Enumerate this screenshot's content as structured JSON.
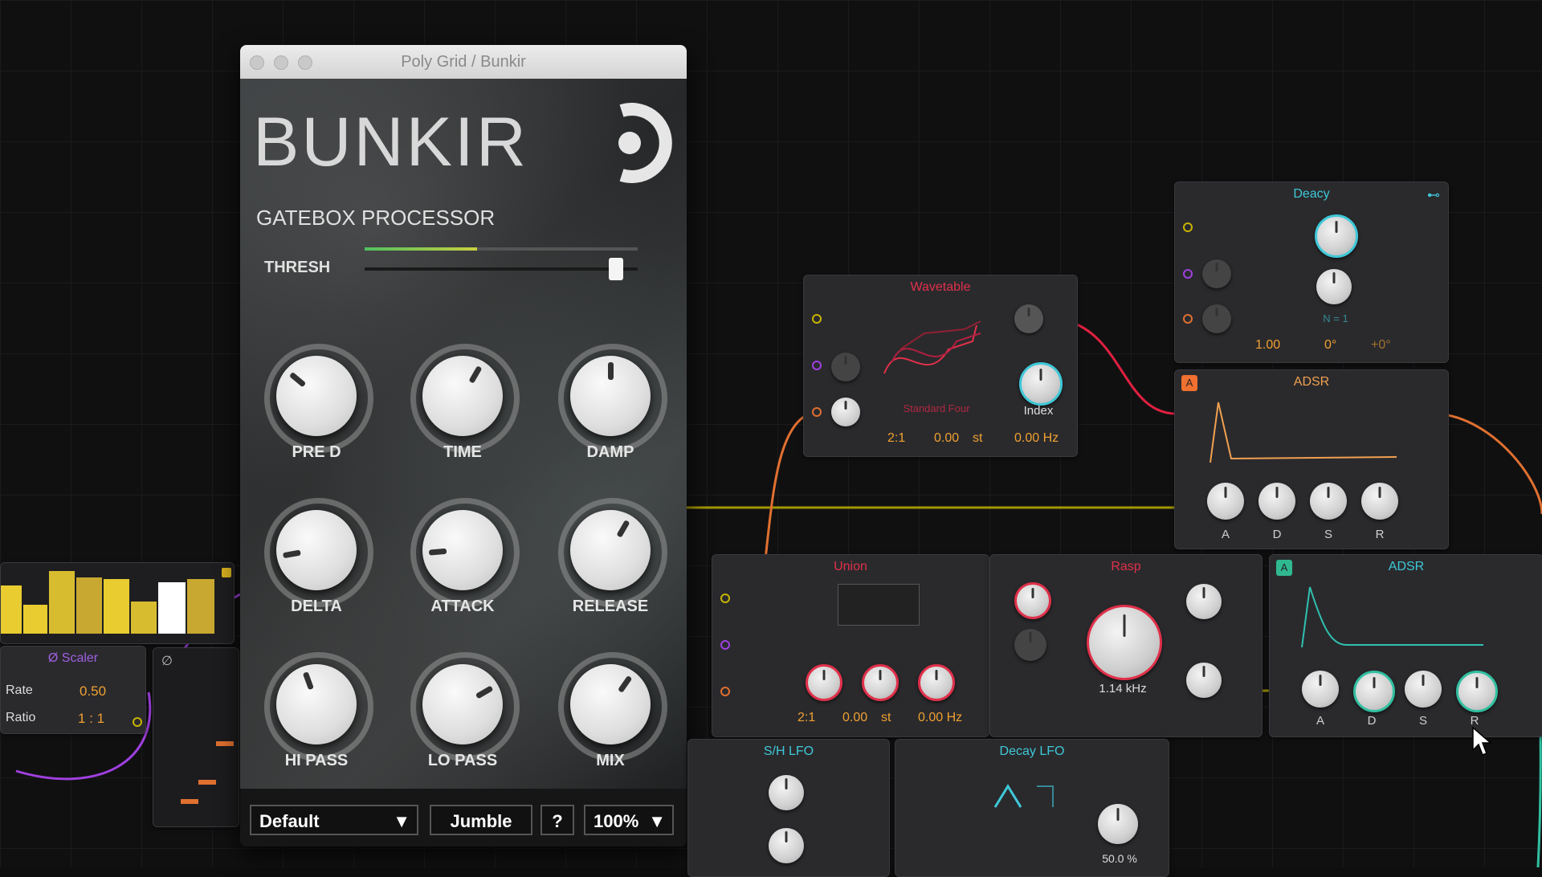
{
  "window": {
    "title": "Poly Grid / Bunkir"
  },
  "plugin": {
    "brand": "BUNKIR",
    "subtitle": "GATEBOX PROCESSOR",
    "thresh_label": "THRESH",
    "knobs": [
      {
        "label": "PRE D"
      },
      {
        "label": "TIME"
      },
      {
        "label": "DAMP"
      },
      {
        "label": "DELTA"
      },
      {
        "label": "ATTACK"
      },
      {
        "label": "RELEASE"
      },
      {
        "label": "HI PASS"
      },
      {
        "label": "LO PASS"
      },
      {
        "label": "MIX"
      }
    ],
    "preset": "Default",
    "jumble": "Jumble",
    "help": "?",
    "zoom": "100%"
  },
  "modules": {
    "deacy": {
      "title": "Deacy",
      "val1": "1.00",
      "val2": "0°",
      "val3": "+0°",
      "n_label": "N = 1"
    },
    "wavetable": {
      "title": "Wavetable",
      "table_name": "Standard Four",
      "index_label": "Index",
      "ratio": "2:1",
      "semitones": "0.00",
      "st_unit": "st",
      "hz": "0.00 Hz"
    },
    "adsr1": {
      "title": "ADSR",
      "labels": [
        "A",
        "D",
        "S",
        "R"
      ]
    },
    "union": {
      "title": "Union",
      "ratio": "2:1",
      "semitones": "0.00",
      "st_unit": "st",
      "hz": "0.00 Hz"
    },
    "rasp": {
      "title": "Rasp",
      "freq": "1.14 kHz"
    },
    "adsr2": {
      "title": "ADSR",
      "labels": [
        "A",
        "D",
        "S",
        "R"
      ]
    },
    "scaler": {
      "title": "Ø Scaler",
      "rate_label": "Rate",
      "rate_value": "0.50",
      "ratio_label": "Ratio",
      "ratio_value": "1 : 1"
    },
    "sh_lfo": {
      "title": "S/H LFO"
    },
    "decay_lfo": {
      "title": "Decay LFO",
      "pct": "50.0 %"
    }
  },
  "colors": {
    "wavetable": "#e0304a",
    "union": "#e0304a",
    "rasp": "#e0304a",
    "deacy": "#3fc8d8",
    "adsr": "#f0a050",
    "scaler": "#a060e0",
    "lfo": "#3fc8d8"
  }
}
